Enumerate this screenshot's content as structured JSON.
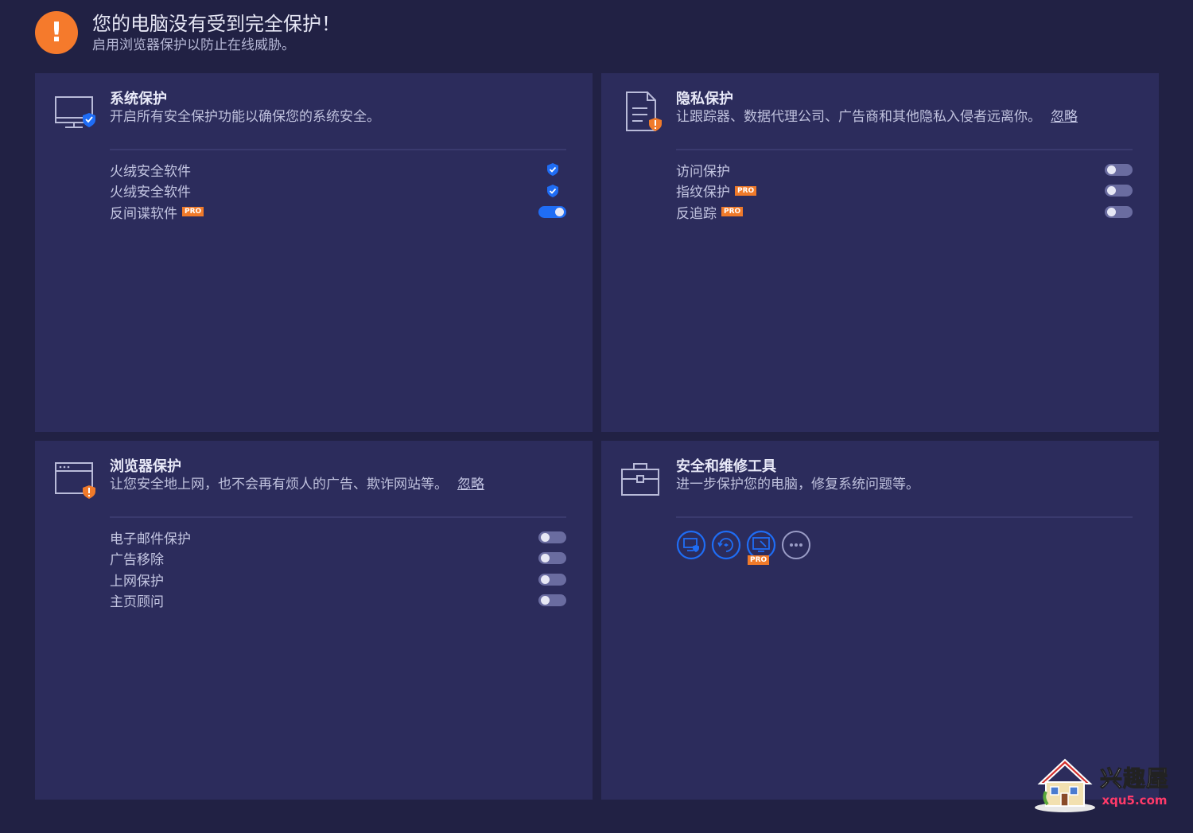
{
  "alert": {
    "title": "您的电脑没有受到完全保护！",
    "subtitle": "启用浏览器保护以防止在线威胁。"
  },
  "system": {
    "title": "系统保护",
    "desc": "开启所有安全保护功能以确保您的系统安全。",
    "items": [
      {
        "label": "火绒安全软件",
        "state": "shield"
      },
      {
        "label": "火绒安全软件",
        "state": "shield"
      },
      {
        "label": "反间谍软件",
        "pro": "PRO",
        "state": "on"
      }
    ]
  },
  "privacy": {
    "title": "隐私保护",
    "desc": "让跟踪器、数据代理公司、广告商和其他隐私入侵者远离你。",
    "ignore": "忽略",
    "items": [
      {
        "label": "访问保护",
        "state": "off"
      },
      {
        "label": "指纹保护",
        "pro": "PRO",
        "state": "off"
      },
      {
        "label": "反追踪",
        "pro": "PRO",
        "state": "off"
      }
    ]
  },
  "browser": {
    "title": "浏览器保护",
    "desc": "让您安全地上网，也不会再有烦人的广告、欺诈网站等。",
    "ignore": "忽略",
    "items": [
      {
        "label": "电子邮件保护",
        "state": "off"
      },
      {
        "label": "广告移除",
        "state": "off"
      },
      {
        "label": "上网保护",
        "state": "off"
      },
      {
        "label": "主页顾问",
        "state": "off"
      }
    ]
  },
  "tools": {
    "title": "安全和维修工具",
    "desc": "进一步保护您的电脑，修复系统问题等。",
    "buttons": [
      {
        "icon": "pc-shield-icon"
      },
      {
        "icon": "repair-icon"
      },
      {
        "icon": "screen-tool-icon",
        "pro": "PRO"
      },
      {
        "icon": "more-icon"
      }
    ]
  },
  "watermark": {
    "cn": "兴趣屋",
    "url": "xqu5.com"
  },
  "colors": {
    "background": "#212144",
    "panel": "#2c2c5c",
    "accent_blue": "#1f6df5",
    "alert_orange": "#f57a2c"
  }
}
